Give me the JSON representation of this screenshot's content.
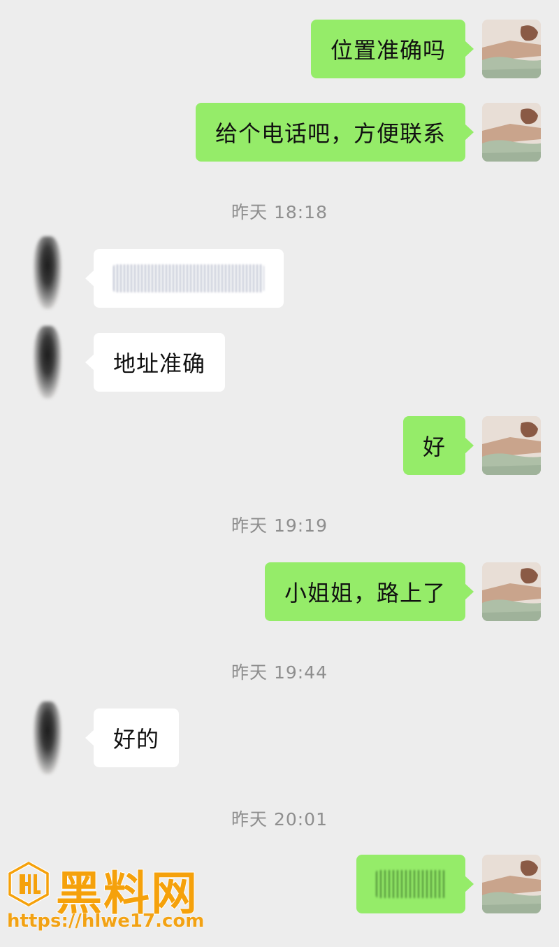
{
  "messages": [
    {
      "direction": "out",
      "text": "位置准确吗"
    },
    {
      "direction": "out",
      "text": "给个电话吧，方便联系"
    },
    {
      "type": "timestamp",
      "text": "昨天 18:18"
    },
    {
      "direction": "in",
      "text": "",
      "redacted": true
    },
    {
      "direction": "in",
      "text": "地址准确"
    },
    {
      "direction": "out",
      "text": "好"
    },
    {
      "type": "timestamp",
      "text": "昨天 19:19"
    },
    {
      "direction": "out",
      "text": "小姐姐，路上了"
    },
    {
      "type": "timestamp",
      "text": "昨天 19:44"
    },
    {
      "direction": "in",
      "text": "好的"
    },
    {
      "type": "timestamp",
      "text": "昨天 20:01"
    },
    {
      "direction": "out",
      "text": "",
      "redacted": true
    }
  ],
  "watermark": {
    "title": "黑料网",
    "url": "https://hlwe17.com"
  },
  "colors": {
    "background": "#ededed",
    "outgoing_bubble": "#95ec69",
    "incoming_bubble": "#ffffff",
    "timestamp_text": "#8e8e8e",
    "watermark": "#f5a10b"
  },
  "icons": {
    "self_avatar": "profile-photo-avatar",
    "contact_avatar": "blurred-contact-avatar",
    "watermark_logo": "hl-logo-icon"
  }
}
